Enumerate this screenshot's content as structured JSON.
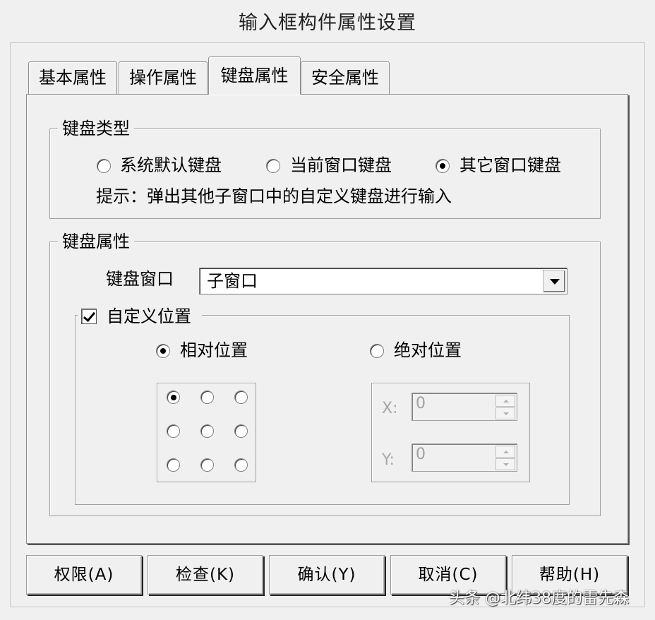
{
  "dialog": {
    "title": "输入框构件属性设置"
  },
  "tabs": [
    {
      "label": "基本属性",
      "active": false
    },
    {
      "label": "操作属性",
      "active": false
    },
    {
      "label": "键盘属性",
      "active": true
    },
    {
      "label": "安全属性",
      "active": false
    }
  ],
  "keyboard_type": {
    "group_label": "键盘类型",
    "options": [
      {
        "label": "系统默认键盘",
        "selected": false
      },
      {
        "label": "当前窗口键盘",
        "selected": false
      },
      {
        "label": "其它窗口键盘",
        "selected": true
      }
    ],
    "hint": "提示：弹出其他子窗口中的自定义键盘进行输入"
  },
  "keyboard_props": {
    "group_label": "键盘属性",
    "window_label": "键盘窗口",
    "window_value": "子窗口",
    "custom_position": {
      "label": "自定义位置",
      "checked": true,
      "relative_label": "相对位置",
      "relative_selected": true,
      "absolute_label": "绝对位置",
      "absolute_selected": false,
      "anchor_grid": [
        [
          true,
          false,
          false
        ],
        [
          false,
          false,
          false
        ],
        [
          false,
          false,
          false
        ]
      ],
      "x_label": "X:",
      "x_value": "0",
      "y_label": "Y:",
      "y_value": "0"
    }
  },
  "buttons": [
    {
      "label": "权限(A)"
    },
    {
      "label": "检查(K)"
    },
    {
      "label": "确认(Y)"
    },
    {
      "label": "取消(C)"
    },
    {
      "label": "帮助(H)"
    }
  ],
  "watermark": "头条 @北纬38度的雷先森"
}
